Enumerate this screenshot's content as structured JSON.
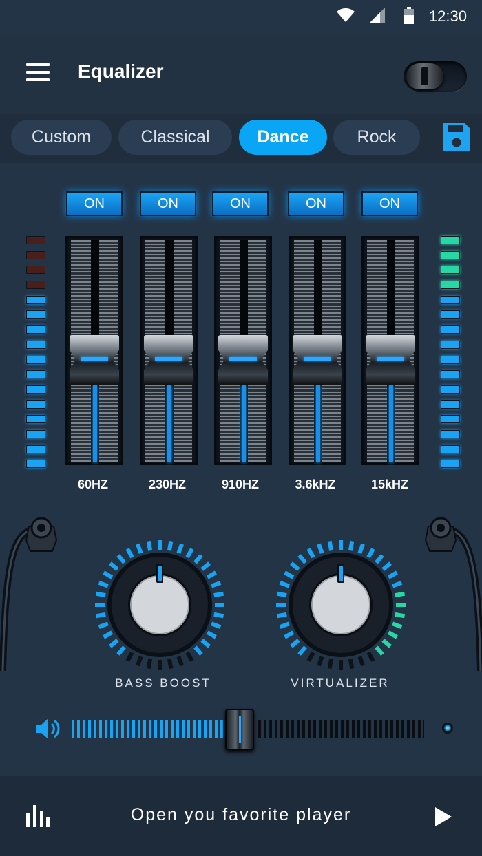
{
  "status": {
    "time": "12:30",
    "icons": [
      "wifi-icon",
      "cellular-signal-icon",
      "battery-icon"
    ]
  },
  "header": {
    "title": "Equalizer",
    "menu_icon": "menu-icon",
    "power_toggle": "on"
  },
  "presets": {
    "items": [
      {
        "label": "Custom",
        "active": false
      },
      {
        "label": "Classical",
        "active": false
      },
      {
        "label": "Dance",
        "active": true
      },
      {
        "label": "Rock",
        "active": false
      }
    ],
    "save_icon": "save-icon"
  },
  "bands": [
    {
      "label": "60HZ",
      "on_label": "ON",
      "level": 0.45
    },
    {
      "label": "230HZ",
      "on_label": "ON",
      "level": 0.45
    },
    {
      "label": "910HZ",
      "on_label": "ON",
      "level": 0.45
    },
    {
      "label": "3.6kHZ",
      "on_label": "ON",
      "level": 0.45
    },
    {
      "label": "15kHZ",
      "on_label": "ON",
      "level": 0.45
    }
  ],
  "meters": {
    "left": [
      "off",
      "off",
      "off",
      "off",
      "blue",
      "blue",
      "blue",
      "blue",
      "blue",
      "blue",
      "blue",
      "blue",
      "blue",
      "blue",
      "blue",
      "blue"
    ],
    "right": [
      "green",
      "green",
      "green",
      "green",
      "blue",
      "blue",
      "blue",
      "blue",
      "blue",
      "blue",
      "blue",
      "blue",
      "blue",
      "blue",
      "blue",
      "blue"
    ]
  },
  "knobs": [
    {
      "label": "BASS BOOST",
      "level": 0.9
    },
    {
      "label": "VIRTUALIZER",
      "level": 0.9
    }
  ],
  "volume": {
    "level": 0.47,
    "icon": "speaker-icon"
  },
  "footer": {
    "text": "Open you favorite player",
    "eq_icon": "equalizer-bars-icon",
    "play_icon": "play-icon"
  },
  "colors": {
    "accent": "#0aa6f5",
    "background": "#243447",
    "meter_green": "#27d8a6",
    "meter_blue": "#1aa3f2"
  }
}
